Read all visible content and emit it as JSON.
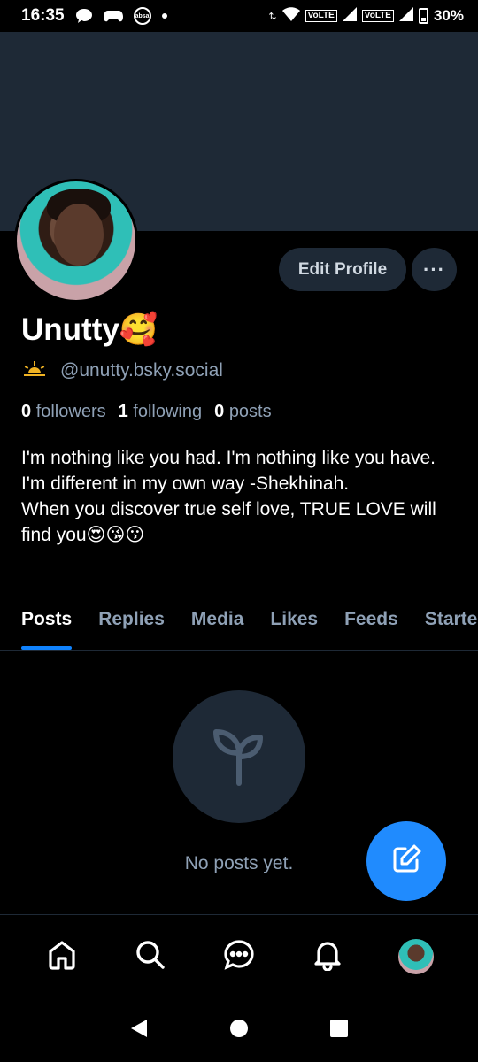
{
  "status_bar": {
    "time": "16:35",
    "absa_label": "absa",
    "volte_1": "VoLTE",
    "volte_2": "VoLTE",
    "battery": "30%"
  },
  "profile": {
    "display_name": "Unutty🥰",
    "handle": "@unutty.bsky.social",
    "handle_icon": "sun-icon",
    "followers_count": "0",
    "followers_label": "followers",
    "following_count": "1",
    "following_label": "following",
    "posts_count": "0",
    "posts_label": "posts",
    "bio": "I'm nothing like you had. I'm nothing like you have. I'm different in my own way -Shekhinah.\nWhen you discover true self love,  TRUE LOVE will find you😍😘😗"
  },
  "actions": {
    "edit_profile_label": "Edit Profile",
    "more_label": "···"
  },
  "tabs": [
    {
      "label": "Posts",
      "active": true
    },
    {
      "label": "Replies",
      "active": false
    },
    {
      "label": "Media",
      "active": false
    },
    {
      "label": "Likes",
      "active": false
    },
    {
      "label": "Feeds",
      "active": false
    },
    {
      "label": "Starter Packs",
      "active": false
    }
  ],
  "empty_state": {
    "icon": "sprout-icon",
    "text": "No posts yet."
  },
  "colors": {
    "background": "#000000",
    "banner": "#1e2936",
    "accent": "#208bfe",
    "muted_text": "#8fa1b6"
  }
}
